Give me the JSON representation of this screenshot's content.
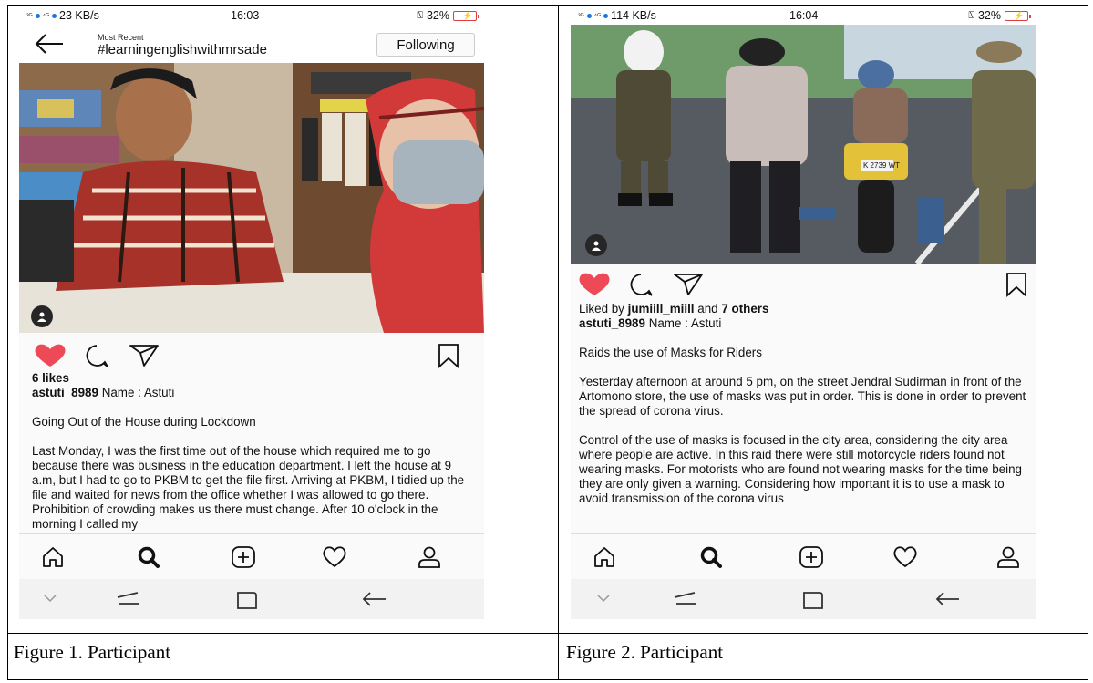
{
  "left": {
    "status": {
      "speed": "23 KB/s",
      "time": "16:03",
      "battery": "32%"
    },
    "header": {
      "subtitle": "Most Recent",
      "hashtag": "#learningenglishwithmrsade",
      "follow_label": "Following"
    },
    "likes": "6 likes",
    "user": "astuti_8989",
    "user_caption": "Name : Astuti",
    "title": "Going Out of the House during Lockdown",
    "body": "Last Monday, I was the first time out of the house which required me to go because there was business in the education department. I left the house at 9 a.m, but I had to go to PKBM to get the file first. Arriving at PKBM, I tidied up the file and waited for news from the office whether I was allowed to go there. Prohibition of crowding makes us there must change. After 10 o'clock in the morning I called my"
  },
  "right": {
    "status": {
      "speed": "114 KB/s",
      "time": "16:04",
      "battery": "32%"
    },
    "plate": "K 2739 WT",
    "liked_prefix": "Liked by",
    "liked_user": "jumiill_miill",
    "liked_and": "and",
    "liked_others": "7 others",
    "user": "astuti_8989",
    "user_caption": "Name : Astuti",
    "title": "Raids the use of Masks for Riders",
    "para1": "Yesterday afternoon at around 5 pm, on the street Jendral Sudirman in front of the Artomono store, the use of masks was put in order. This is done in order to prevent the spread of corona virus.",
    "para2": "Control of the use of masks is focused in the city area, considering the city area where people are active. In this raid there were still motorcycle riders found not wearing masks. For motorists who are found not wearing masks for the time being they are only given a warning. Considering how important it is to use a mask to avoid transmission of the corona virus"
  },
  "captions": {
    "figure1": "Figure 1. Participant",
    "figure2": "Figure 2. Participant"
  },
  "colors": {
    "like_red": "#ed4956",
    "text": "#111111"
  },
  "icons": [
    "back-arrow-icon",
    "heart-icon",
    "comment-icon",
    "share-icon",
    "bookmark-icon",
    "home-icon",
    "search-icon",
    "add-post-icon",
    "activity-icon",
    "profile-icon",
    "user-tag-icon"
  ]
}
